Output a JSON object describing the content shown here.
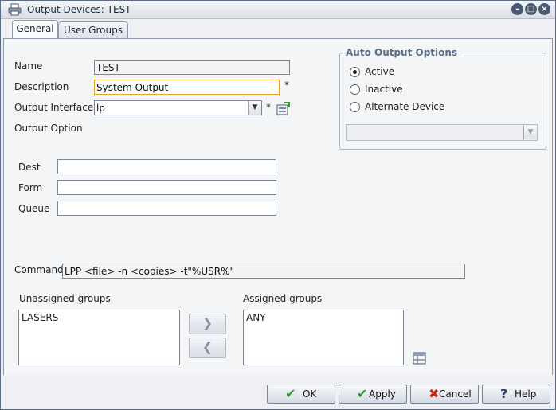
{
  "window": {
    "title": "Output Devices: TEST"
  },
  "tabs": [
    {
      "label": "General",
      "active": true
    },
    {
      "label": "User Groups",
      "active": false
    }
  ],
  "form": {
    "name_label": "Name",
    "name_value": "TEST",
    "description_label": "Description",
    "description_value": "System Output",
    "output_interface_label": "Output Interface",
    "output_interface_value": "lp",
    "output_option_label": "Output Option",
    "required_mark": "*",
    "dest_label": "Dest",
    "form_label": "Form",
    "queue_label": "Queue",
    "command_label": "Command",
    "command_value": "LPP <file> -n <copies> -t\"%USR%\""
  },
  "auto_output": {
    "title": "Auto Output Options",
    "options": [
      {
        "label": "Active",
        "selected": true
      },
      {
        "label": "Inactive",
        "selected": false
      },
      {
        "label": "Alternate Device",
        "selected": false
      }
    ]
  },
  "groups": {
    "unassigned_label": "Unassigned groups",
    "unassigned_items": [
      "LASERS"
    ],
    "assigned_label": "Assigned groups",
    "assigned_items": [
      "ANY"
    ],
    "move_right_glyph": "❯",
    "move_left_glyph": "❮"
  },
  "buttons": {
    "ok": "OK",
    "apply": "Apply",
    "cancel": "Cancel",
    "help": "Help"
  },
  "colors": {
    "ok_check": "#2f9a2f",
    "cancel_x": "#c0281e",
    "help_q": "#2d3f6a"
  }
}
